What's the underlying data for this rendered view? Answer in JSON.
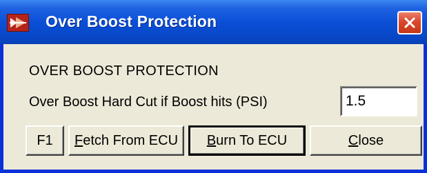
{
  "window": {
    "title": "Over Boost Protection",
    "close_label": "Close window"
  },
  "content": {
    "section_label": "OVER BOOST PROTECTION",
    "field_label": "Over Boost Hard Cut if Boost hits (PSI)",
    "field_value": "1.5"
  },
  "buttons": {
    "f1": "F1",
    "fetch_first": "F",
    "fetch_rest": "etch From ECU",
    "burn_first": "B",
    "burn_rest": "urn To ECU",
    "close_first": "C",
    "close_rest": "lose"
  },
  "colors": {
    "titlebar": "#0a4fd6",
    "frame": "#0831d9",
    "dialog_bg": "#ece9d8",
    "close_button": "#d9482c"
  },
  "icons": {
    "app": "app-icon",
    "close": "close-icon"
  }
}
